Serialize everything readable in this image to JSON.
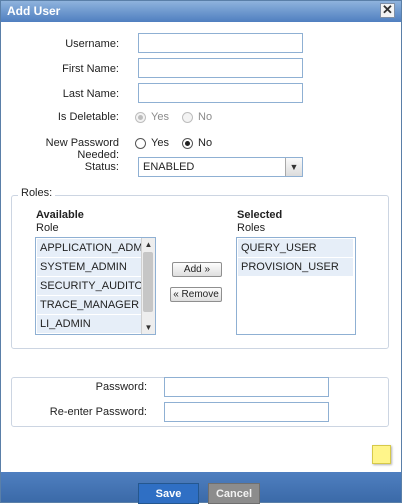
{
  "dialog": {
    "title": "Add User",
    "close_symbol": "✕"
  },
  "form": {
    "username_label": "Username:",
    "username_value": "",
    "first_name_label": "First Name:",
    "first_name_value": "",
    "last_name_label": "Last Name:",
    "last_name_value": "",
    "is_deletable_label": "Is Deletable:",
    "is_deletable_options": [
      "Yes",
      "No"
    ],
    "is_deletable_selected": "Yes",
    "new_password_label": "New Password Needed:",
    "new_password_options": [
      "Yes",
      "No"
    ],
    "new_password_selected": "No",
    "status_label": "Status:",
    "status_value": "ENABLED"
  },
  "roles": {
    "legend": "Roles:",
    "available_heading": "Available",
    "available_subheading": "Role",
    "available_items": [
      "APPLICATION_ADMIN",
      "SYSTEM_ADMIN",
      "SECURITY_AUDITOR",
      "TRACE_MANAGER",
      "LI_ADMIN"
    ],
    "selected_heading": "Selected",
    "selected_subheading": "Roles",
    "selected_items": [
      "QUERY_USER",
      "PROVISION_USER"
    ],
    "add_label": "Add »",
    "remove_label": "« Remove"
  },
  "password": {
    "password_label": "Password:",
    "password_value": "",
    "reenter_label": "Re-enter Password:",
    "reenter_value": ""
  },
  "footer": {
    "save_label": "Save",
    "cancel_label": "Cancel"
  }
}
